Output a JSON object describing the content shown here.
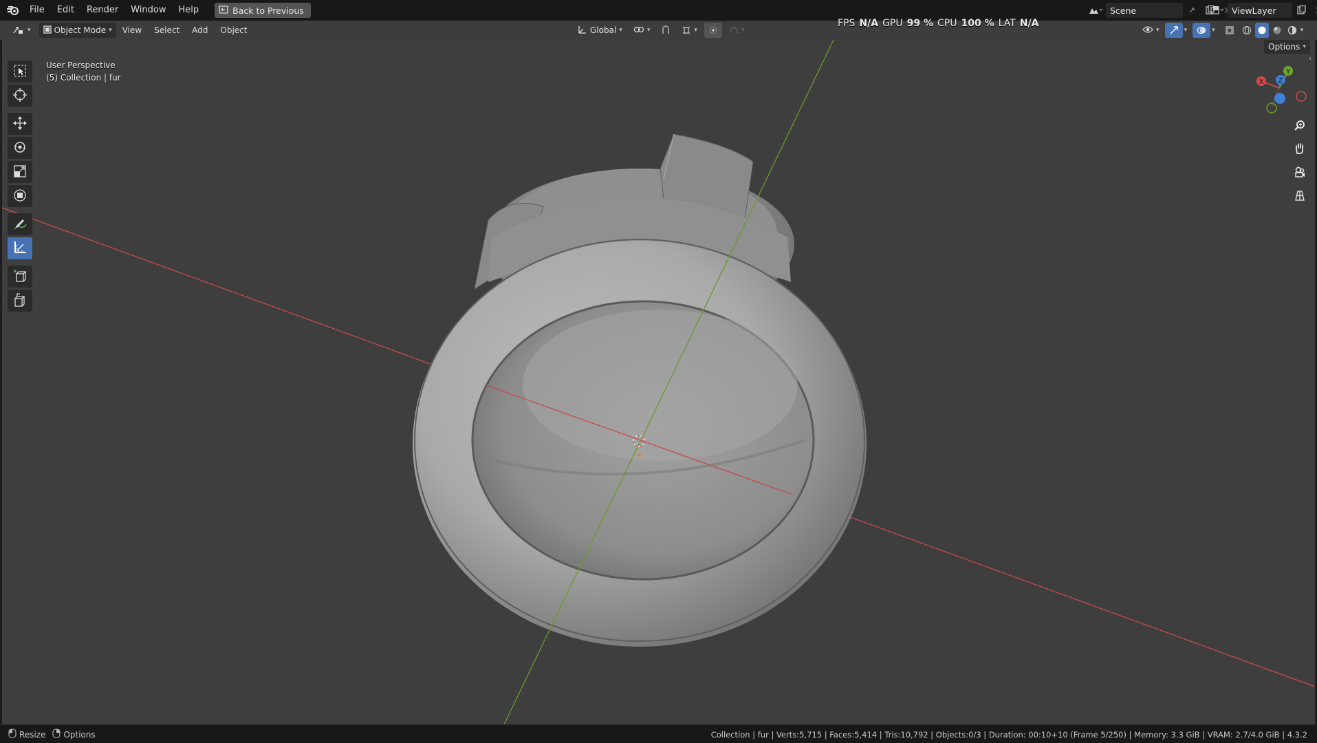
{
  "topbar": {
    "menu": [
      "File",
      "Edit",
      "Render",
      "Window",
      "Help"
    ],
    "back_button": "Back to Previous",
    "scene_label": "Scene",
    "viewlayer_label": "ViewLayer"
  },
  "header": {
    "mode": "Object Mode",
    "menus": [
      "View",
      "Select",
      "Add",
      "Object"
    ],
    "orientation": "Global",
    "options_label": "Options"
  },
  "stats": {
    "fps_label": "FPS",
    "fps_value": "N/A",
    "gpu_label": "GPU",
    "gpu_value": "99 %",
    "cpu_label": "CPU",
    "cpu_value": "100 %",
    "lat_label": "LAT",
    "lat_value": "N/A"
  },
  "viewport": {
    "view_name": "User Perspective",
    "collection_info": "(5) Collection | fur",
    "gizmo_axes": {
      "x": "X",
      "y": "Y",
      "z": "Z"
    }
  },
  "statusbar": {
    "resize_label": "Resize",
    "options_label": "Options",
    "info": "Collection | fur | Verts:5,715 | Faces:5,414 | Tris:10,792 | Objects:0/3 | Duration: 00:10+10 (Frame 5/250) | Memory: 3.3 GiB | VRAM: 2.7/4.0 GiB | 4.3.2"
  },
  "colors": {
    "x_axis": "#c84a4a",
    "y_axis": "#6a9a2a",
    "accent": "#4772b3",
    "viewport_bg": "#3e3e3e"
  },
  "icons": {
    "toolbar": [
      "select-box-icon",
      "cursor-icon",
      "move-icon",
      "rotate-icon",
      "scale-icon",
      "transform-icon",
      "annotate-icon",
      "measure-icon",
      "add-cube-icon",
      "extrude-icon"
    ],
    "navigation": [
      "zoom-icon",
      "hand-pan-icon",
      "camera-icon",
      "grid-icon"
    ]
  }
}
